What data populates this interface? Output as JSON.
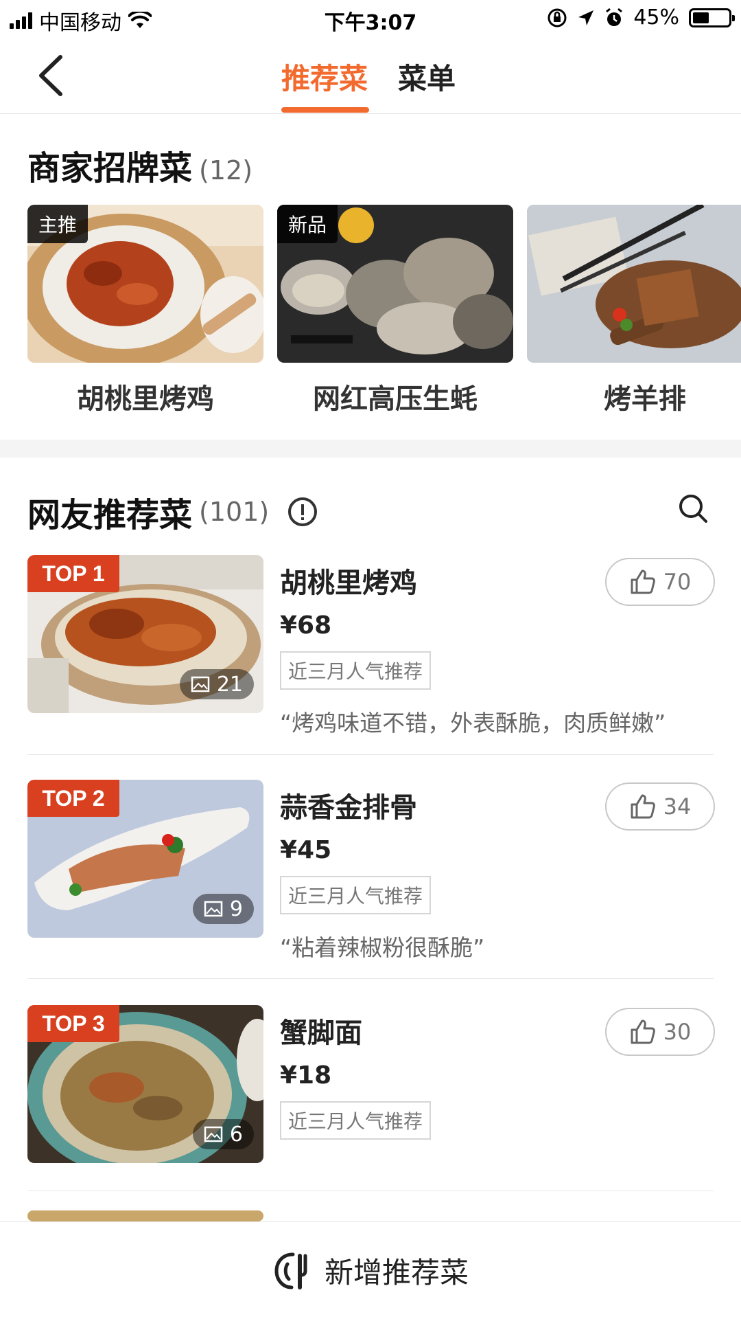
{
  "status_bar": {
    "carrier": "中国移动",
    "time": "下午3:07",
    "battery": "45%",
    "battery_level": 0.45
  },
  "nav": {
    "tabs": [
      {
        "label": "推荐菜",
        "active": true
      },
      {
        "label": "菜单",
        "active": false
      }
    ]
  },
  "signature": {
    "title": "商家招牌菜",
    "count": "(12)",
    "items": [
      {
        "name": "胡桃里烤鸡",
        "badge": "主推"
      },
      {
        "name": "网红高压生蚝",
        "badge": "新品"
      },
      {
        "name": "烤羊排",
        "badge": ""
      }
    ]
  },
  "recommended": {
    "title": "网友推荐菜",
    "count": "(101)",
    "dishes": [
      {
        "rank": "TOP 1",
        "name": "胡桃里烤鸡",
        "price": "¥68",
        "tag": "近三月人气推荐",
        "quote": "“烤鸡味道不错，外表酥脆，肉质鲜嫩”",
        "likes": "70",
        "photos": "21"
      },
      {
        "rank": "TOP 2",
        "name": "蒜香金排骨",
        "price": "¥45",
        "tag": "近三月人气推荐",
        "quote": "“粘着辣椒粉很酥脆”",
        "likes": "34",
        "photos": "9"
      },
      {
        "rank": "TOP 3",
        "name": "蟹脚面",
        "price": "¥18",
        "tag": "近三月人气推荐",
        "quote": "",
        "likes": "30",
        "photos": "6"
      }
    ]
  },
  "bottom_bar": {
    "label": "新增推荐菜"
  },
  "colors": {
    "accent": "#f26a2e",
    "top_badge": "#d8401f"
  },
  "icons": [
    "back-chevron-icon",
    "wifi-icon",
    "orientation-lock-icon",
    "location-arrow-icon",
    "alarm-icon",
    "info-icon",
    "search-icon",
    "image-icon",
    "thumbs-up-icon",
    "add-dish-icon"
  ]
}
